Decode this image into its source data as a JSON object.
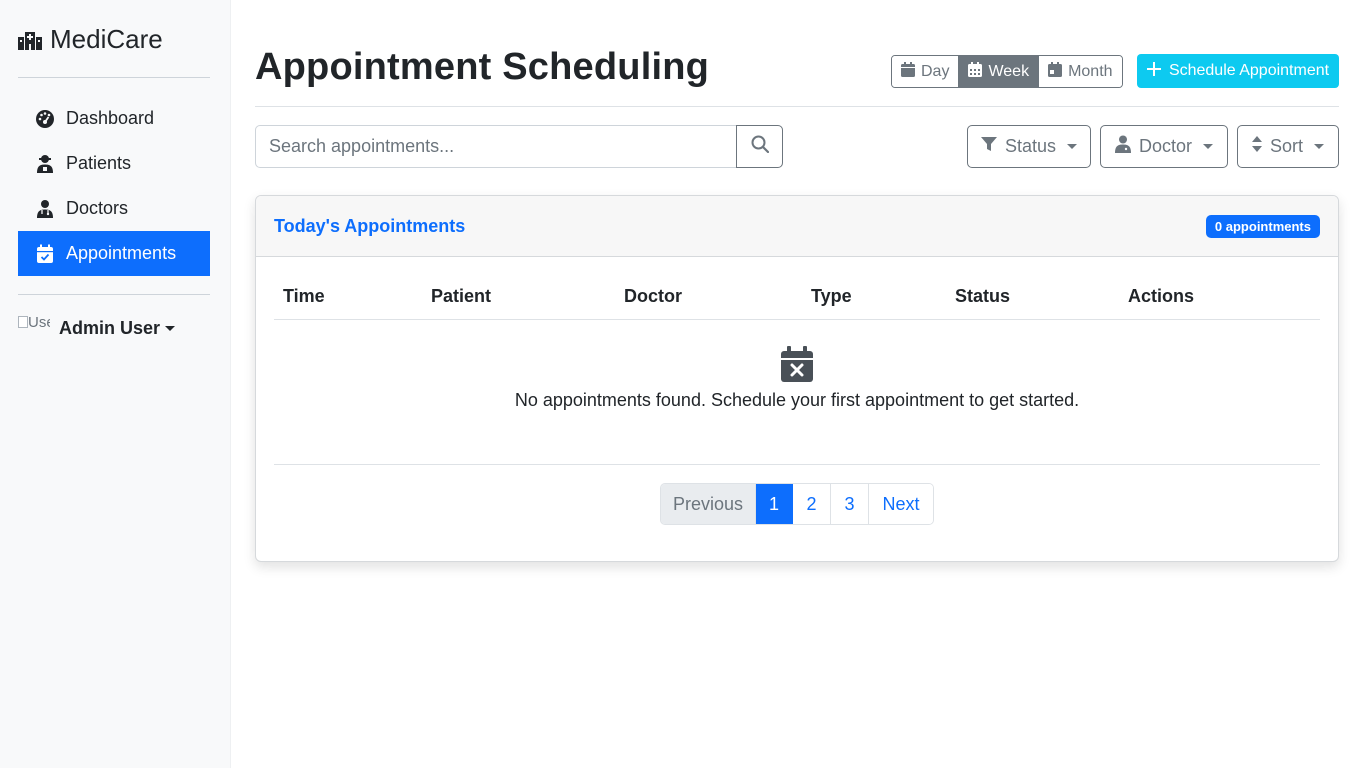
{
  "brand": {
    "name": "MediCare"
  },
  "sidebar": {
    "items": [
      {
        "label": "Dashboard",
        "icon": "dashboard-gauge-icon",
        "active": false
      },
      {
        "label": "Patients",
        "icon": "patient-icon",
        "active": false
      },
      {
        "label": "Doctors",
        "icon": "doctor-icon",
        "active": false
      },
      {
        "label": "Appointments",
        "icon": "calendar-check-icon",
        "active": true
      }
    ],
    "user": {
      "name": "Admin User",
      "avatar_alt": "User"
    }
  },
  "header": {
    "title": "Appointment Scheduling",
    "view_toggle": [
      {
        "label": "Day",
        "icon": "calendar-day-icon",
        "active": false
      },
      {
        "label": "Week",
        "icon": "calendar-week-icon",
        "active": true
      },
      {
        "label": "Month",
        "icon": "calendar-month-icon",
        "active": false
      }
    ],
    "schedule_button": "Schedule Appointment"
  },
  "toolbar": {
    "search_placeholder": "Search appointments...",
    "search_value": "",
    "filters": [
      {
        "label": "Status",
        "icon": "filter-icon"
      },
      {
        "label": "Doctor",
        "icon": "doctor-icon"
      },
      {
        "label": "Sort",
        "icon": "sort-icon"
      }
    ]
  },
  "card": {
    "title": "Today's Appointments",
    "badge": "0 appointments",
    "columns": [
      "Time",
      "Patient",
      "Doctor",
      "Type",
      "Status",
      "Actions"
    ],
    "empty_message": "No appointments found. Schedule your first appointment to get started."
  },
  "pagination": {
    "previous": "Previous",
    "pages": [
      "1",
      "2",
      "3"
    ],
    "current": "1",
    "next": "Next"
  },
  "colors": {
    "primary": "#0d6efd",
    "info": "#0dcaf0",
    "secondary": "#6c757d",
    "sidebar_bg": "#f8f9fa"
  }
}
